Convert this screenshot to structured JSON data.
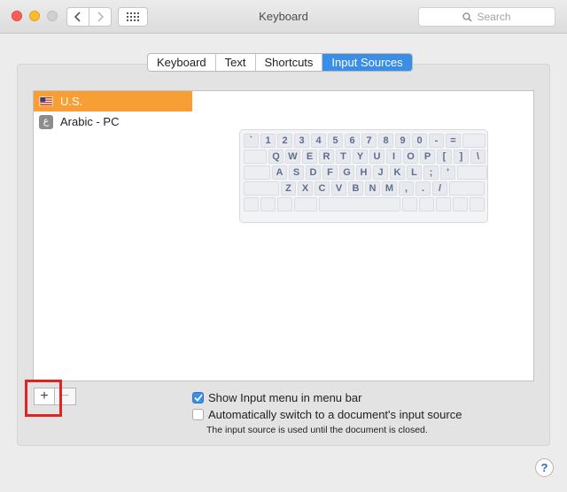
{
  "window": {
    "title": "Keyboard"
  },
  "search": {
    "placeholder": "Search"
  },
  "tabs": [
    {
      "label": "Keyboard"
    },
    {
      "label": "Text"
    },
    {
      "label": "Shortcuts"
    },
    {
      "label": "Input Sources",
      "active": true
    }
  ],
  "sources": [
    {
      "label": "U.S.",
      "icon": "us-flag-icon",
      "selected": true
    },
    {
      "label": "Arabic - PC",
      "icon": "arabic-script-icon",
      "icon_glyph": "ع"
    }
  ],
  "keyboard": {
    "rows": [
      [
        "`",
        "1",
        "2",
        "3",
        "4",
        "5",
        "6",
        "7",
        "8",
        "9",
        "0",
        "-",
        "="
      ],
      [
        "Q",
        "W",
        "E",
        "R",
        "T",
        "Y",
        "U",
        "I",
        "O",
        "P",
        "[",
        "]",
        "\\"
      ],
      [
        "A",
        "S",
        "D",
        "F",
        "G",
        "H",
        "J",
        "K",
        "L",
        ";",
        "'"
      ],
      [
        "Z",
        "X",
        "C",
        "V",
        "B",
        "N",
        "M",
        ",",
        ".",
        "/"
      ]
    ]
  },
  "controls": {
    "add_label": "+",
    "remove_label": "−"
  },
  "options": {
    "show_menu": {
      "label": "Show Input menu in menu bar",
      "checked": true
    },
    "auto_switch": {
      "label": "Automatically switch to a document's input source",
      "checked": false
    },
    "note": "The input source is used until the document is closed."
  },
  "help": {
    "label": "?"
  },
  "colors": {
    "accent": "#3a8ee6",
    "selection": "#f79f35",
    "highlight": "#e02424"
  }
}
